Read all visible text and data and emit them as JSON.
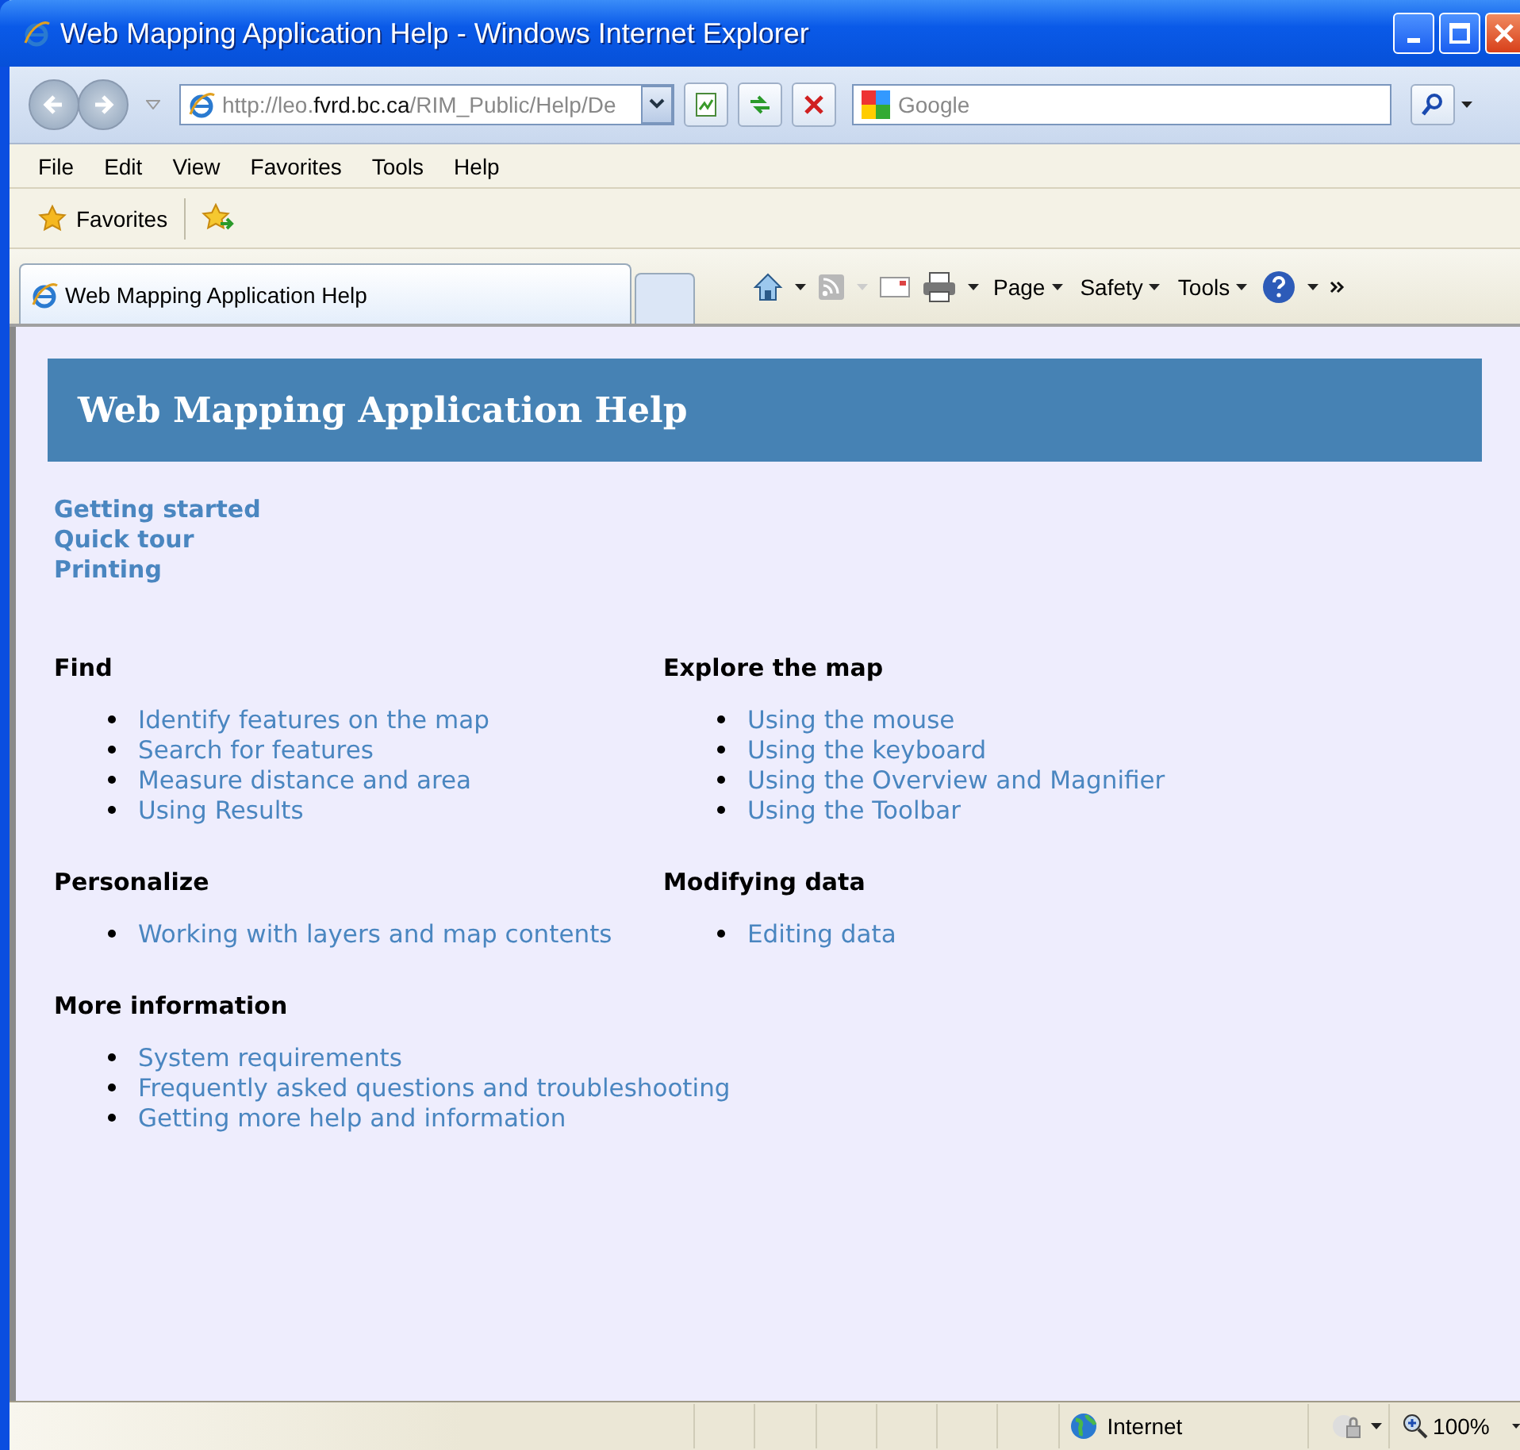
{
  "window": {
    "title": "Web Mapping Application Help - Windows Internet Explorer"
  },
  "address_bar": {
    "url": "http://leo.**fvrd.bc.ca**/RIM_Public/Help/De"
  },
  "search": {
    "placeholder": "Google"
  },
  "menu": [
    "File",
    "Edit",
    "View",
    "Favorites",
    "Tools",
    "Help"
  ],
  "favorites_bar": {
    "label": "Favorites"
  },
  "tabs": [
    {
      "label": "Web Mapping Application Help",
      "selected": true
    }
  ],
  "command_bar": [
    "Page",
    "Safety",
    "Tools"
  ],
  "page": {
    "heading": "Web Mapping Application Help",
    "top_links": [
      "Getting started",
      "Quick tour",
      "Printing"
    ],
    "sections": [
      {
        "title": "Find",
        "links": [
          "Identify features on the map",
          "Search for features",
          "Measure distance and area",
          "Using Results"
        ]
      },
      {
        "title": "Explore the map",
        "links": [
          "Using the mouse",
          "Using the keyboard",
          "Using the Overview and Magnifier",
          "Using the Toolbar"
        ]
      },
      {
        "title": "Personalize",
        "links": [
          "Working with layers and map contents"
        ]
      },
      {
        "title": "Modifying data",
        "links": [
          "Editing data"
        ]
      },
      {
        "title": "More information",
        "links": [
          "System requirements",
          "Frequently asked questions and troubleshooting",
          "Getting more help and information"
        ]
      }
    ]
  },
  "status_bar": {
    "zone": "Internet",
    "zoom": "100%"
  }
}
